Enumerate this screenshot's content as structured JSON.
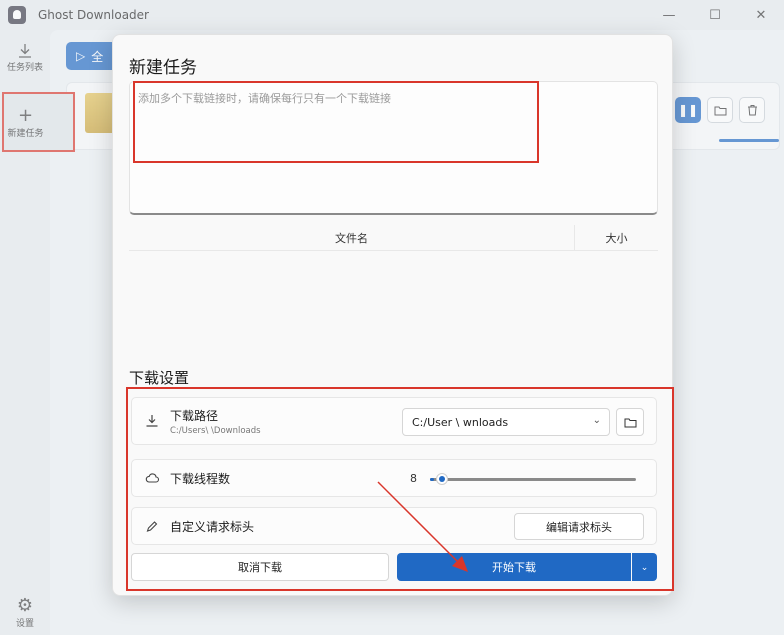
{
  "window": {
    "title": "Ghost Downloader",
    "minimize": "—",
    "maximize": "☐",
    "close": "✕"
  },
  "nav": {
    "tasks_label": "任务列表",
    "new_label": "新建任务",
    "settings_label": "设置"
  },
  "background": {
    "all_button": "全"
  },
  "dialog": {
    "title": "新建任务",
    "url_placeholder": "添加多个下载链接时，请确保每行只有一个下载链接",
    "columns": {
      "filename": "文件名",
      "size": "大小"
    },
    "settings_title": "下载设置",
    "path": {
      "label": "下载路径",
      "value": "C:/Users\\          \\Downloads",
      "selected": "C:/User          \\       wnloads"
    },
    "threads": {
      "label": "下载线程数",
      "value": "8",
      "fraction": 0.02
    },
    "headers": {
      "label": "自定义请求标头",
      "button": "编辑请求标头"
    },
    "cancel_button": "取消下载",
    "start_button": "开始下载"
  },
  "colors": {
    "accent": "#2069c4",
    "highlight": "#d9362b"
  }
}
